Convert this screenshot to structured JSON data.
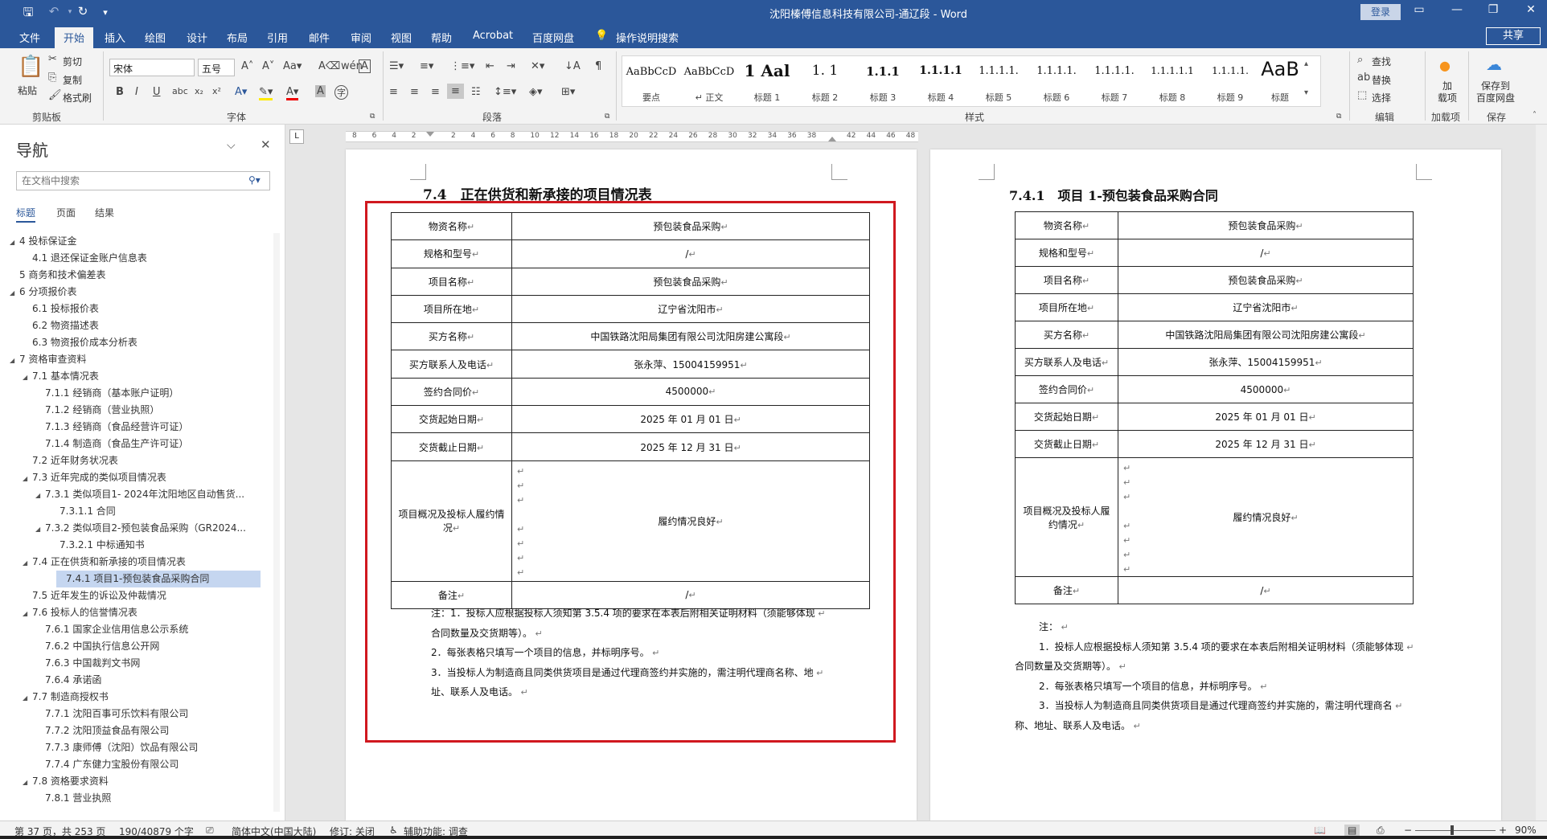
{
  "window": {
    "title": "沈阳榛傅信息科技有限公司-通辽段  -  Word",
    "login": "登录",
    "share": "共享"
  },
  "tabs": [
    "文件",
    "开始",
    "插入",
    "绘图",
    "设计",
    "布局",
    "引用",
    "邮件",
    "审阅",
    "视图",
    "帮助",
    "Acrobat",
    "百度网盘"
  ],
  "tell_me": "操作说明搜索",
  "ribbon": {
    "clipboard": {
      "paste": "粘贴",
      "cut": "剪切",
      "copy": "复制",
      "format_painter": "格式刷",
      "label": "剪贴板"
    },
    "font": {
      "name": "宋体",
      "size": "五号",
      "label": "字体"
    },
    "paragraph": {
      "label": "段落"
    },
    "styles": {
      "label": "样式",
      "items": [
        {
          "sample": "AaBbCcD",
          "name": "要点"
        },
        {
          "sample": "AaBbCcD",
          "name": "↵ 正文"
        },
        {
          "sample": "1 Aal",
          "name": "标题 1"
        },
        {
          "sample": "1. 1",
          "name": "标题 2"
        },
        {
          "sample": "1.1.1",
          "name": "标题 3"
        },
        {
          "sample": "1.1.1.1",
          "name": "标题 4"
        },
        {
          "sample": "1.1.1.1.",
          "name": "标题 5"
        },
        {
          "sample": "1.1.1.1.",
          "name": "标题 6"
        },
        {
          "sample": "1.1.1.1.",
          "name": "标题 7"
        },
        {
          "sample": "1.1.1.1.1",
          "name": "标题 8"
        },
        {
          "sample": "1.1.1.1.",
          "name": "标题 9"
        },
        {
          "sample": "AaB",
          "name": "标题"
        }
      ]
    },
    "editing": {
      "find": "查找",
      "replace": "替换",
      "select": "选择",
      "label": "编辑"
    },
    "addins": {
      "btn": "加\n载项",
      "label": "加载项"
    },
    "save": {
      "btn": "保存到\n百度网盘",
      "label": "保存"
    }
  },
  "nav": {
    "title": "导航",
    "search_placeholder": "在文档中搜索",
    "tabs": [
      "标题",
      "页面",
      "结果"
    ],
    "items": [
      {
        "text": "4 投标保证金",
        "level": 0,
        "tri": "◢"
      },
      {
        "text": "4.1 退还保证金账户信息表",
        "level": 1,
        "tri": ""
      },
      {
        "text": "5 商务和技术偏差表",
        "level": 0,
        "tri": ""
      },
      {
        "text": "6 分项报价表",
        "level": 0,
        "tri": "◢"
      },
      {
        "text": "6.1 投标报价表",
        "level": 1,
        "tri": ""
      },
      {
        "text": "6.2 物资描述表",
        "level": 1,
        "tri": ""
      },
      {
        "text": "6.3 物资报价成本分析表",
        "level": 1,
        "tri": ""
      },
      {
        "text": "7 资格审查资料",
        "level": 0,
        "tri": "◢"
      },
      {
        "text": "7.1 基本情况表",
        "level": 1,
        "tri": "◢"
      },
      {
        "text": "7.1.1 经销商（基本账户证明）",
        "level": 2,
        "tri": ""
      },
      {
        "text": "7.1.2 经销商（营业执照）",
        "level": 2,
        "tri": ""
      },
      {
        "text": "7.1.3 经销商（食品经营许可证）",
        "level": 2,
        "tri": ""
      },
      {
        "text": "7.1.4 制造商（食品生产许可证）",
        "level": 2,
        "tri": ""
      },
      {
        "text": "7.2 近年财务状况表",
        "level": 1,
        "tri": ""
      },
      {
        "text": "7.3 近年完成的类似项目情况表",
        "level": 1,
        "tri": "◢"
      },
      {
        "text": "7.3.1 类似项目1- 2024年沈阳地区自动售货...",
        "level": 2,
        "tri": "◢"
      },
      {
        "text": "7.3.1.1 合同",
        "level": 3,
        "tri": ""
      },
      {
        "text": "7.3.2 类似项目2-预包装食品采购（GR2024...",
        "level": 2,
        "tri": "◢"
      },
      {
        "text": "7.3.2.1 中标通知书",
        "level": 3,
        "tri": ""
      },
      {
        "text": "7.4 正在供货和新承接的项目情况表",
        "level": 1,
        "tri": "◢"
      },
      {
        "text": "7.4.1 项目1-预包装食品采购合同",
        "level": 2,
        "tri": "",
        "sel": true
      },
      {
        "text": "7.5 近年发生的诉讼及仲裁情况",
        "level": 1,
        "tri": ""
      },
      {
        "text": "7.6 投标人的信誉情况表",
        "level": 1,
        "tri": "◢"
      },
      {
        "text": "7.6.1 国家企业信用信息公示系统",
        "level": 2,
        "tri": ""
      },
      {
        "text": "7.6.2 中国执行信息公开网",
        "level": 2,
        "tri": ""
      },
      {
        "text": "7.6.3 中国裁判文书网",
        "level": 2,
        "tri": ""
      },
      {
        "text": "7.6.4 承诺函",
        "level": 2,
        "tri": ""
      },
      {
        "text": "7.7 制造商授权书",
        "level": 1,
        "tri": "◢"
      },
      {
        "text": "7.7.1 沈阳百事可乐饮料有限公司",
        "level": 2,
        "tri": ""
      },
      {
        "text": "7.7.2 沈阳顶益食品有限公司",
        "level": 2,
        "tri": ""
      },
      {
        "text": "7.7.3 康师傅（沈阳）饮品有限公司",
        "level": 2,
        "tri": ""
      },
      {
        "text": "7.7.4 广东健力宝股份有限公司",
        "level": 2,
        "tri": ""
      },
      {
        "text": "7.8 资格要求资料",
        "level": 1,
        "tri": "◢"
      },
      {
        "text": "7.8.1 营业执照",
        "level": 2,
        "tri": ""
      }
    ]
  },
  "ruler_labels": [
    "8",
    "6",
    "4",
    "2",
    "",
    "2",
    "4",
    "6",
    "8",
    "10",
    "12",
    "14",
    "16",
    "18",
    "20",
    "22",
    "24",
    "26",
    "28",
    "30",
    "32",
    "34",
    "36",
    "38",
    "",
    "42",
    "44",
    "46",
    "48"
  ],
  "left_page": {
    "heading": "7.4　正在供货和新承接的项目情况表",
    "rows": [
      [
        "物资名称",
        "预包装食品采购"
      ],
      [
        "规格和型号",
        "/"
      ],
      [
        "项目名称",
        "预包装食品采购"
      ],
      [
        "项目所在地",
        "辽宁省沈阳市"
      ],
      [
        "买方名称",
        "中国铁路沈阳局集团有限公司沈阳房建公寓段"
      ],
      [
        "买方联系人及电话",
        "张永萍、15004159951"
      ],
      [
        "签约合同价",
        "4500000"
      ],
      [
        "交货起始日期",
        "2025 年 01 月 01 日"
      ],
      [
        "交货截止日期",
        "2025 年 12 月 31 日"
      ],
      [
        "项目概况及投标人履约情况",
        "履约情况良好"
      ],
      [
        "备注",
        "/"
      ]
    ],
    "notes": [
      "注：1．投标人应根据投标人须知第 3.5.4 项的要求在本表后附相关证明材料（须能够体现",
      "合同数量及交货期等）。",
      "2．每张表格只填写一个项目的信息，并标明序号。",
      "3．当投标人为制造商且同类供货项目是通过代理商签约并实施的，需注明代理商名称、地",
      "址、联系人及电话。"
    ]
  },
  "right_page": {
    "heading": "7.4.1　项目 1-预包装食品采购合同",
    "rows": [
      [
        "物资名称",
        "预包装食品采购"
      ],
      [
        "规格和型号",
        "/"
      ],
      [
        "项目名称",
        "预包装食品采购"
      ],
      [
        "项目所在地",
        "辽宁省沈阳市"
      ],
      [
        "买方名称",
        "中国铁路沈阳局集团有限公司沈阳房建公寓段"
      ],
      [
        "买方联系人及电话",
        "张永萍、15004159951"
      ],
      [
        "签约合同价",
        "4500000"
      ],
      [
        "交货起始日期",
        "2025 年 01 月 01 日"
      ],
      [
        "交货截止日期",
        "2025 年 12 月 31 日"
      ],
      [
        "项目概况及投标人履约情况",
        "履约情况良好"
      ],
      [
        "备注",
        "/"
      ]
    ],
    "notes": [
      "注：",
      "1．投标人应根据投标人须知第 3.5.4 项的要求在本表后附相关证明材料（须能够体现",
      "合同数量及交货期等）。",
      "2．每张表格只填写一个项目的信息，并标明序号。",
      "3．当投标人为制造商且同类供货项目是通过代理商签约并实施的，需注明代理商名",
      "称、地址、联系人及电话。"
    ]
  },
  "status": {
    "page": "第 37 页，共 253 页",
    "words": "190/40879 个字",
    "lang": "简体中文(中国大陆)",
    "track": "修订: 关闭",
    "access": "辅助功能: 调查",
    "zoom": "90%"
  }
}
